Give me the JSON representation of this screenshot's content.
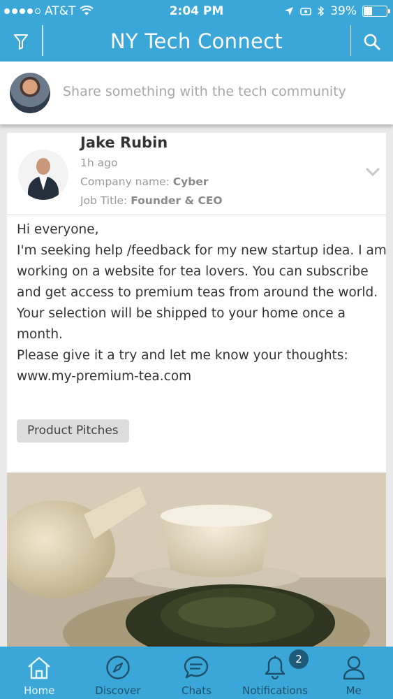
{
  "status_bar": {
    "carrier": "AT&T",
    "time": "2:04 PM",
    "battery_percent": "39%",
    "battery_level": 0.39,
    "signal_bars_filled": 4,
    "icons": [
      "wifi-icon",
      "location-arrow-icon",
      "alarm-icon",
      "bluetooth-icon",
      "battery-icon"
    ]
  },
  "navbar": {
    "title": "NY Tech Connect",
    "left_icon": "filter-icon",
    "right_icon": "search-icon"
  },
  "composer": {
    "placeholder": "Share something with the tech community",
    "avatar_icon": "user-avatar"
  },
  "post": {
    "author": "Jake Rubin",
    "time_ago": "1h ago",
    "company_label": "Company name:",
    "company": "Cyber",
    "job_label": "Job Title:",
    "job_title": "Founder & CEO",
    "body_lines": [
      "Hi everyone,",
      "I'm seeking help /feedback for my new startup idea. I am",
      "working on a website for tea lovers. You can subscribe",
      "and get access to premium teas from around the world.",
      "Your selection will be shipped to your home once a",
      "month.",
      "Please give it a try and let me know your thoughts:",
      "www.my-premium-tea.com"
    ],
    "tag": "Product Pitches",
    "menu_icon": "chevron-down-icon",
    "image": "tea-photo"
  },
  "tabbar": {
    "items": [
      {
        "label": "Home",
        "icon": "home-icon",
        "active": true
      },
      {
        "label": "Discover",
        "icon": "compass-icon",
        "active": false
      },
      {
        "label": "Chats",
        "icon": "chat-bubble-icon",
        "active": false
      },
      {
        "label": "Notifications",
        "icon": "bell-icon",
        "active": false,
        "badge": "2"
      },
      {
        "label": "Me",
        "icon": "person-icon",
        "active": false
      }
    ]
  },
  "colors": {
    "brand": "#3aa7d8",
    "tab_icon": "#1e4f6b",
    "badge": "#1e5a7a"
  }
}
